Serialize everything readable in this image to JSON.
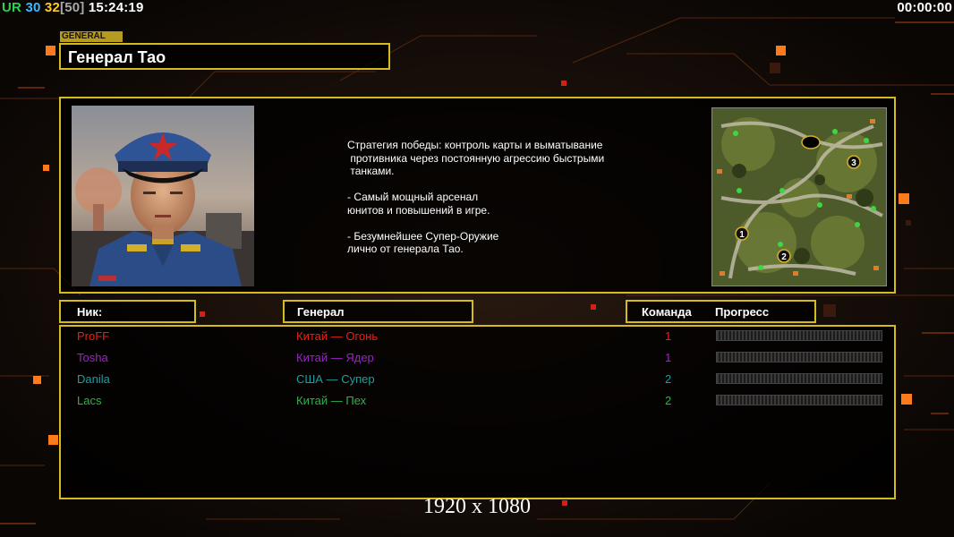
{
  "overlay": {
    "left": {
      "ur": "UR",
      "n30": "30",
      "n32": "32",
      "n50": "[50]",
      "clock": "15:24:19"
    },
    "right_timer": "00:00:00"
  },
  "general_tag": "GENERAL",
  "general_name": "Генерал Тао",
  "description": "Стратегия победы: контроль карты и выматывание\n противника через постоянную агрессию быстрыми\n танками.\n\n- Самый мощный арсенал\nюнитов и повышений в игре.\n\n- Безумнейшее Супер-Оружие\nлично от генерала Тао.",
  "headers": {
    "nick": "Ник:",
    "general": "Генерал",
    "team": "Команда",
    "progress": "Прогресс"
  },
  "players": [
    {
      "nick": "ProFF",
      "general": "Китай — Огонь",
      "team": "1",
      "color": "#e8201c"
    },
    {
      "nick": "Tosha",
      "general": "Китай — Ядер",
      "team": "1",
      "color": "#9a24c8"
    },
    {
      "nick": "Danila",
      "general": "США — Супер",
      "team": "2",
      "color": "#1d9ea0"
    },
    {
      "nick": "Lacs",
      "general": "Китай — Пех",
      "team": "2",
      "color": "#2fb24a"
    }
  ],
  "map_markers": [
    "1",
    "2",
    "3"
  ],
  "resolution": "1920 x 1080",
  "colors": {
    "accent": "#d6bb1c",
    "orange": "#ff7a1a"
  }
}
